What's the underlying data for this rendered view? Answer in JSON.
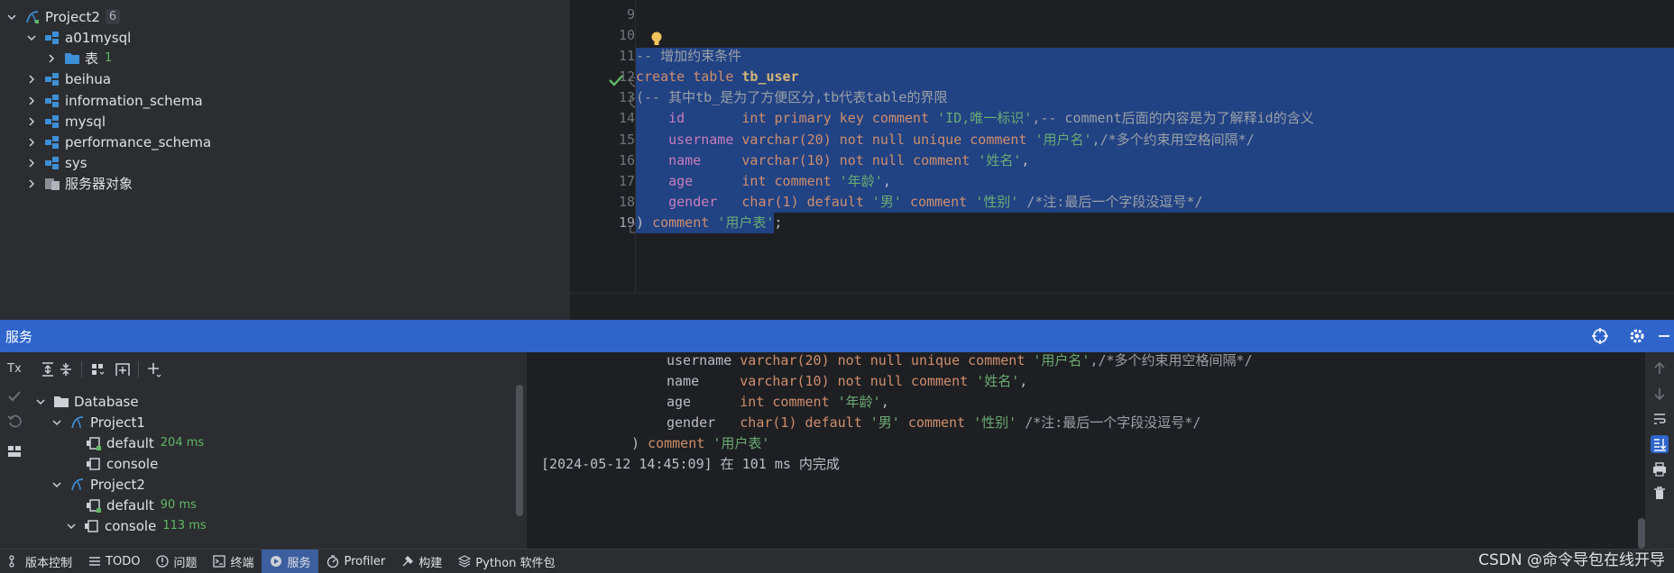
{
  "db_tree": {
    "items": [
      {
        "label": "Project2",
        "badge": "6",
        "expanded": true,
        "icon": "datasource-icon"
      },
      {
        "label": "a01mysql",
        "expanded": true,
        "icon": "schema-icon"
      },
      {
        "label": "表",
        "count": "1",
        "expanded": false,
        "icon": "folder-icon"
      },
      {
        "label": "beihua",
        "expanded": false,
        "icon": "schema-icon"
      },
      {
        "label": "information_schema",
        "expanded": false,
        "icon": "schema-icon"
      },
      {
        "label": "mysql",
        "expanded": false,
        "icon": "schema-icon"
      },
      {
        "label": "performance_schema",
        "expanded": false,
        "icon": "schema-icon"
      },
      {
        "label": "sys",
        "expanded": false,
        "icon": "schema-icon"
      },
      {
        "label": "服务器对象",
        "expanded": false,
        "icon": "server-objects-icon"
      }
    ]
  },
  "editor": {
    "line_numbers": [
      "9",
      "10",
      "11",
      "12",
      "13",
      "14",
      "15",
      "16",
      "17",
      "18",
      "19"
    ],
    "lines": {
      "l11": "-- 增加约束条件",
      "l12_kw": "create table ",
      "l12_id": "tb_user",
      "l13": "(-- 其中tb_是为了方便区分,tb代表table的界限",
      "l14_col": "    id       ",
      "l14_type": "int primary key comment ",
      "l14_str": "'ID,唯一标识'",
      "l14_rest": ",-- comment后面的内容是为了解释id的含义",
      "l15_col": "    username ",
      "l15_type": "varchar(20) not null unique comment ",
      "l15_str": "'用户名'",
      "l15_rest": ",/*多个约束用空格间隔*/",
      "l16_col": "    name     ",
      "l16_type": "varchar(10) not null comment ",
      "l16_str": "'姓名'",
      "l16_rest": ",",
      "l17_col": "    age      ",
      "l17_type": "int comment ",
      "l17_str": "'年龄'",
      "l17_rest": ",",
      "l18_col": "    gender   ",
      "l18_type1": "char(1) default ",
      "l18_str1": "'男'",
      "l18_type2": " comment ",
      "l18_str2": "'性别'",
      "l18_rest": " /*注:最后一个字段没逗号*/",
      "l19_pre": ") ",
      "l19_kw": "comment ",
      "l19_str": "'用户表'",
      "l19_end": ";"
    }
  },
  "services": {
    "title": "服务",
    "tree": [
      {
        "label": "Database",
        "icon": "folder-icon",
        "expanded": true
      },
      {
        "label": "Project1",
        "icon": "datasource-icon",
        "expanded": true
      },
      {
        "label": "default",
        "time": "204 ms",
        "icon": "session-icon"
      },
      {
        "label": "console",
        "time": "",
        "icon": "session-icon"
      },
      {
        "label": "Project2",
        "icon": "datasource-icon",
        "expanded": true
      },
      {
        "label": "default",
        "time": "90 ms",
        "icon": "session-icon"
      },
      {
        "label": "console",
        "time": "113 ms",
        "icon": "session-icon"
      }
    ],
    "console": {
      "c1_col": "username ",
      "c1_type": "varchar(20) not null unique comment ",
      "c1_str": "'用户名'",
      "c1_rest": ",/*多个约束用空格间隔*/",
      "c2_col": "name     ",
      "c2_type": "varchar(10) not null comment ",
      "c2_str": "'姓名'",
      "c2_rest": ",",
      "c3_col": "age      ",
      "c3_type": "int comment ",
      "c3_str": "'年龄'",
      "c3_rest": ",",
      "c4_col": "gender   ",
      "c4_type1": "char(1) default ",
      "c4_str1": "'男'",
      "c4_type2": " comment ",
      "c4_str2": "'性别'",
      "c4_rest": " /*注:最后一个字段没逗号*/",
      "c5_pre": ") ",
      "c5_kw": "comment ",
      "c5_str": "'用户表'",
      "result": "[2024-05-12 14:45:09] 在 101 ms 内完成"
    },
    "left_toolbar": {
      "tx_label": "Tx"
    }
  },
  "statusbar": {
    "items": [
      {
        "label": "版本控制",
        "icon": "vcs-icon"
      },
      {
        "label": "TODO",
        "icon": "todo-icon"
      },
      {
        "label": "问题",
        "icon": "problems-icon"
      },
      {
        "label": "终端",
        "icon": "terminal-icon"
      },
      {
        "label": "服务",
        "icon": "services-icon",
        "active": true
      },
      {
        "label": "Profiler",
        "icon": "profiler-icon"
      },
      {
        "label": "构建",
        "icon": "build-icon"
      },
      {
        "label": "Python 软件包",
        "icon": "python-packages-icon"
      }
    ],
    "watermark": "CSDN @命令导包在线开导"
  },
  "colors": {
    "selection": "#214283",
    "keyword": "#cf8e6d",
    "string": "#6aab73",
    "comment": "#7a7e85",
    "header_blue": "#2f65ca",
    "success_green": "#5fb865"
  }
}
